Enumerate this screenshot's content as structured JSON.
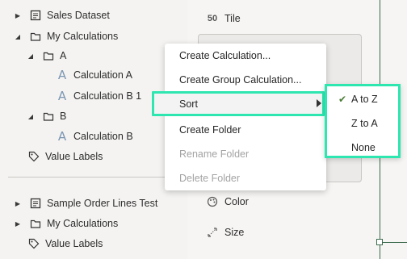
{
  "data_panel": {
    "items": [
      {
        "label": "Sales Dataset"
      },
      {
        "label": "My Calculations"
      },
      {
        "label": "A"
      },
      {
        "label": "Calculation A"
      },
      {
        "label": "Calculation B 1"
      },
      {
        "label": "B"
      },
      {
        "label": "Calculation B"
      },
      {
        "label": "Value Labels"
      },
      {
        "label": "Sample Order Lines Test"
      },
      {
        "label": "My Calculations"
      },
      {
        "label": "Value Labels"
      }
    ]
  },
  "grammar_panel": {
    "tile_label": "Tile",
    "color_label": "Color",
    "size_label": "Size"
  },
  "context_menu": {
    "items": [
      {
        "label": "Create Calculation..."
      },
      {
        "label": "Create Group Calculation..."
      },
      {
        "label": "Sort"
      },
      {
        "label": "Create Folder"
      },
      {
        "label": "Rename Folder"
      },
      {
        "label": "Delete Folder"
      }
    ]
  },
  "sort_submenu": {
    "items": [
      {
        "label": "A to Z",
        "checked": true
      },
      {
        "label": "Z to A",
        "checked": false
      },
      {
        "label": "None",
        "checked": false
      }
    ]
  },
  "colors": {
    "highlight": "#2ee6b0",
    "calc_icon": "#7b95b3",
    "check": "#4a7d35"
  }
}
